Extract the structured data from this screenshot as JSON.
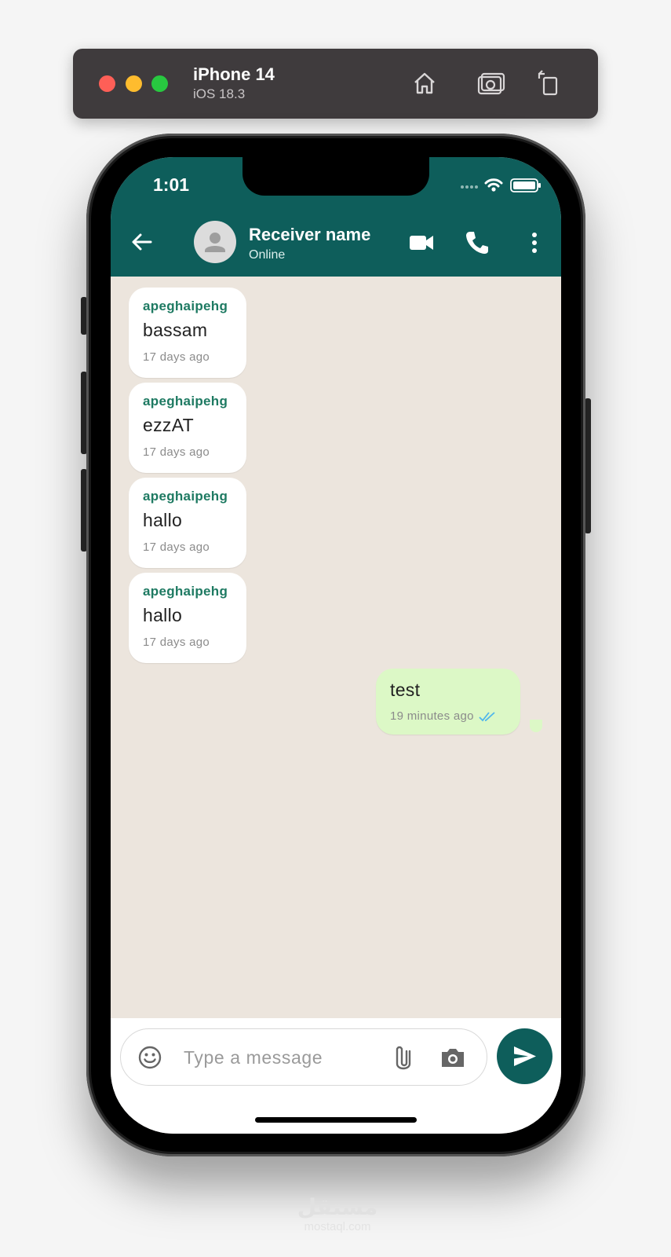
{
  "simulator": {
    "device": "iPhone 14",
    "os": "iOS 18.3",
    "buttons": [
      "home-icon",
      "screenshot-icon",
      "rotate-icon"
    ]
  },
  "status_bar": {
    "time": "1:01"
  },
  "header": {
    "contact_name": "Receiver name",
    "contact_status": "Online",
    "icons": [
      "back-arrow-icon",
      "avatar-icon",
      "video-call-icon",
      "voice-call-icon",
      "more-vert-icon"
    ]
  },
  "messages": [
    {
      "direction": "incoming",
      "sender": "apeghaipehg",
      "text": "bassam",
      "time": "17 days ago"
    },
    {
      "direction": "incoming",
      "sender": "apeghaipehg",
      "text": "ezzAT",
      "time": "17 days ago"
    },
    {
      "direction": "incoming",
      "sender": "apeghaipehg",
      "text": "hallo",
      "time": "17 days ago"
    },
    {
      "direction": "incoming",
      "sender": "apeghaipehg",
      "text": "hallo",
      "time": "17 days ago"
    },
    {
      "direction": "outgoing",
      "text": "test",
      "time": "19 minutes ago",
      "status": "read"
    }
  ],
  "composer": {
    "placeholder": "Type a message",
    "value": "",
    "icons": [
      "emoji-icon",
      "attach-icon",
      "camera-icon",
      "send-icon"
    ]
  },
  "watermark": {
    "logo": "مستقل",
    "domain": "mostaql.com"
  },
  "colors": {
    "header": "#0e5e5b",
    "chat_background": "#ece5dd",
    "incoming_bubble": "#ffffff",
    "outgoing_bubble": "#dcf8c6",
    "sender_name": "#1e7a62",
    "read_ticks": "#4fb6ec"
  }
}
